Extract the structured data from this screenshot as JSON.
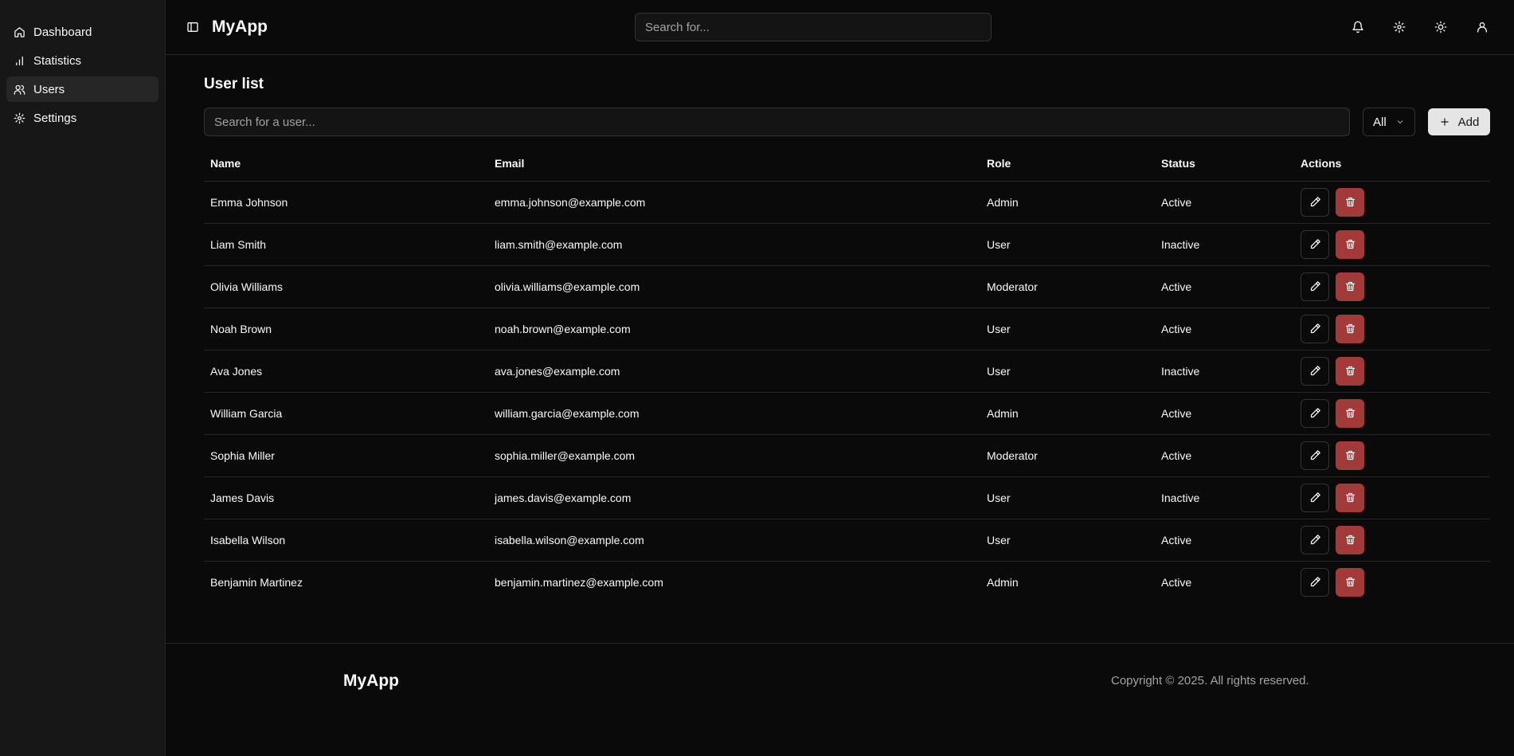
{
  "sidebar": {
    "items": [
      {
        "label": "Dashboard",
        "icon": "home-icon"
      },
      {
        "label": "Statistics",
        "icon": "chart-icon"
      },
      {
        "label": "Users",
        "icon": "users-icon",
        "active": true
      },
      {
        "label": "Settings",
        "icon": "gear-icon"
      }
    ]
  },
  "header": {
    "title": "MyApp",
    "search_placeholder": "Search for..."
  },
  "main": {
    "title": "User list",
    "search_placeholder": "Search for a user...",
    "filter_value": "All",
    "add_label": "Add",
    "columns": [
      "Name",
      "Email",
      "Role",
      "Status",
      "Actions"
    ],
    "rows": [
      {
        "name": "Emma Johnson",
        "email": "emma.johnson@example.com",
        "role": "Admin",
        "status": "Active"
      },
      {
        "name": "Liam Smith",
        "email": "liam.smith@example.com",
        "role": "User",
        "status": "Inactive"
      },
      {
        "name": "Olivia Williams",
        "email": "olivia.williams@example.com",
        "role": "Moderator",
        "status": "Active"
      },
      {
        "name": "Noah Brown",
        "email": "noah.brown@example.com",
        "role": "User",
        "status": "Active"
      },
      {
        "name": "Ava Jones",
        "email": "ava.jones@example.com",
        "role": "User",
        "status": "Inactive"
      },
      {
        "name": "William Garcia",
        "email": "william.garcia@example.com",
        "role": "Admin",
        "status": "Active"
      },
      {
        "name": "Sophia Miller",
        "email": "sophia.miller@example.com",
        "role": "Moderator",
        "status": "Active"
      },
      {
        "name": "James Davis",
        "email": "james.davis@example.com",
        "role": "User",
        "status": "Inactive"
      },
      {
        "name": "Isabella Wilson",
        "email": "isabella.wilson@example.com",
        "role": "User",
        "status": "Active"
      },
      {
        "name": "Benjamin Martinez",
        "email": "benjamin.martinez@example.com",
        "role": "Admin",
        "status": "Active"
      }
    ]
  },
  "footer": {
    "brand": "MyApp",
    "copyright": "Copyright © 2025. All rights reserved."
  },
  "colors": {
    "background": "#0a0a0a",
    "sidebar": "#171717",
    "danger": "#a23a3a",
    "primary_button": "#e5e5e5"
  }
}
